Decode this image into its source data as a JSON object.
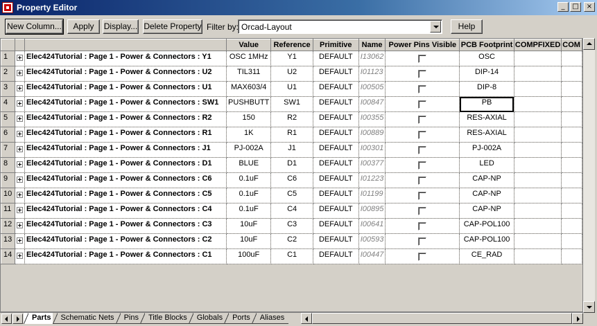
{
  "window": {
    "title": "Property Editor",
    "minimize": "_",
    "maximize": "□",
    "close": "×"
  },
  "toolbar": {
    "new_column": "New Column...",
    "apply": "Apply",
    "display": "Display...",
    "delete_property": "Delete Property",
    "filter_label": "Filter by:",
    "filter_value": "Orcad-Layout",
    "help": "Help"
  },
  "columns": [
    "Value",
    "Reference",
    "Primitive",
    "Name",
    "Power Pins Visible",
    "PCB Footprint",
    "COMPFIXED",
    "COM"
  ],
  "rows": [
    {
      "num": "1",
      "part": "Elec424Tutorial : Page 1 - Power & Connectors : Y1",
      "value": "OSC 1MHz",
      "reference": "Y1",
      "primitive": "DEFAULT",
      "name": "I13062",
      "footprint": "OSC"
    },
    {
      "num": "2",
      "part": "Elec424Tutorial : Page 1 - Power & Connectors : U2",
      "value": "TIL311",
      "reference": "U2",
      "primitive": "DEFAULT",
      "name": "I01123",
      "footprint": "DIP-14"
    },
    {
      "num": "3",
      "part": "Elec424Tutorial : Page 1 - Power & Connectors : U1",
      "value": "MAX603/4",
      "reference": "U1",
      "primitive": "DEFAULT",
      "name": "I00505",
      "footprint": "DIP-8"
    },
    {
      "num": "4",
      "part": "Elec424Tutorial : Page 1 - Power & Connectors : SW1",
      "value": "PUSHBUTT",
      "reference": "SW1",
      "primitive": "DEFAULT",
      "name": "I00847",
      "footprint": "PB"
    },
    {
      "num": "5",
      "part": "Elec424Tutorial : Page 1 - Power & Connectors : R2",
      "value": "150",
      "reference": "R2",
      "primitive": "DEFAULT",
      "name": "I00355",
      "footprint": "RES-AXIAL"
    },
    {
      "num": "6",
      "part": "Elec424Tutorial : Page 1 - Power & Connectors : R1",
      "value": "1K",
      "reference": "R1",
      "primitive": "DEFAULT",
      "name": "I00889",
      "footprint": "RES-AXIAL"
    },
    {
      "num": "7",
      "part": "Elec424Tutorial : Page 1 - Power & Connectors : J1",
      "value": "PJ-002A",
      "reference": "J1",
      "primitive": "DEFAULT",
      "name": "I00301",
      "footprint": "PJ-002A"
    },
    {
      "num": "8",
      "part": "Elec424Tutorial : Page 1 - Power & Connectors : D1",
      "value": "BLUE",
      "reference": "D1",
      "primitive": "DEFAULT",
      "name": "I00377",
      "footprint": "LED"
    },
    {
      "num": "9",
      "part": "Elec424Tutorial : Page 1 - Power & Connectors : C6",
      "value": "0.1uF",
      "reference": "C6",
      "primitive": "DEFAULT",
      "name": "I01223",
      "footprint": "CAP-NP"
    },
    {
      "num": "10",
      "part": "Elec424Tutorial : Page 1 - Power & Connectors : C5",
      "value": "0.1uF",
      "reference": "C5",
      "primitive": "DEFAULT",
      "name": "I01199",
      "footprint": "CAP-NP"
    },
    {
      "num": "11",
      "part": "Elec424Tutorial : Page 1 - Power & Connectors : C4",
      "value": "0.1uF",
      "reference": "C4",
      "primitive": "DEFAULT",
      "name": "I00895",
      "footprint": "CAP-NP"
    },
    {
      "num": "12",
      "part": "Elec424Tutorial : Page 1 - Power & Connectors : C3",
      "value": "10uF",
      "reference": "C3",
      "primitive": "DEFAULT",
      "name": "I00641",
      "footprint": "CAP-POL100"
    },
    {
      "num": "13",
      "part": "Elec424Tutorial : Page 1 - Power & Connectors : C2",
      "value": "10uF",
      "reference": "C2",
      "primitive": "DEFAULT",
      "name": "I00593",
      "footprint": "CAP-POL100"
    },
    {
      "num": "14",
      "part": "Elec424Tutorial : Page 1 - Power & Connectors : C1",
      "value": "100uF",
      "reference": "C1",
      "primitive": "DEFAULT",
      "name": "I00447",
      "footprint": "CE_RAD"
    }
  ],
  "selected_cell": {
    "row": "4",
    "column": "PCB Footprint"
  },
  "tabs": [
    "Parts",
    "Schematic Nets",
    "Pins",
    "Title Blocks",
    "Globals",
    "Ports",
    "Aliases"
  ],
  "active_tab": "Parts"
}
